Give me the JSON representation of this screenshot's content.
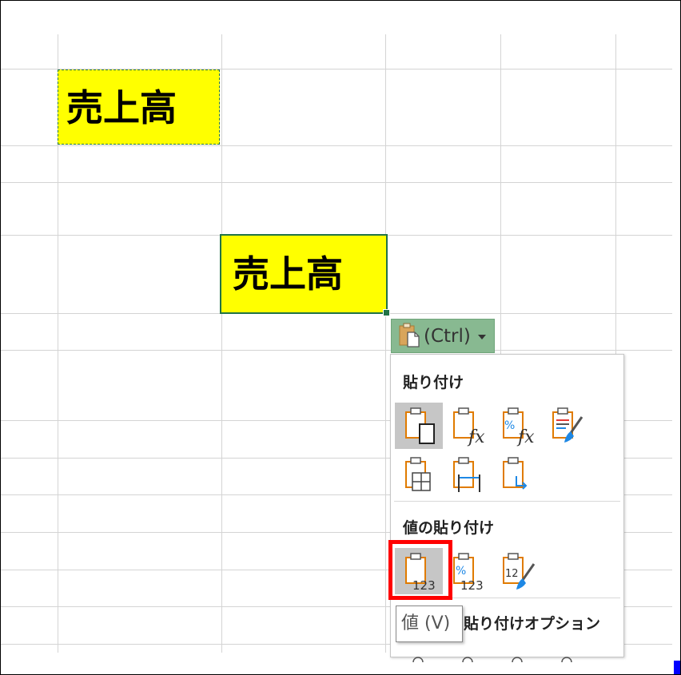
{
  "cells": {
    "copied_text": "売上高",
    "pasted_text": "売上高"
  },
  "paste_options_button": {
    "label": "(Ctrl)"
  },
  "paste_menu": {
    "section_paste": "貼り付け",
    "section_values": "値の貼り付け",
    "section_other": "その他の貼り付けオプション",
    "paste_icons": [
      "paste-icon",
      "paste-formulas-icon",
      "paste-formulas-number-format-icon",
      "keep-source-formatting-icon",
      "no-borders-icon",
      "keep-column-widths-icon",
      "transpose-icon"
    ],
    "value_icons": [
      "paste-values-icon",
      "values-number-format-icon",
      "values-source-formatting-icon"
    ]
  },
  "tooltip": {
    "text": "値 (V)"
  },
  "colors": {
    "excel_green": "#217346",
    "cell_fill": "#ffff00",
    "highlight": "#ff0000",
    "button_bg": "#88b991"
  }
}
